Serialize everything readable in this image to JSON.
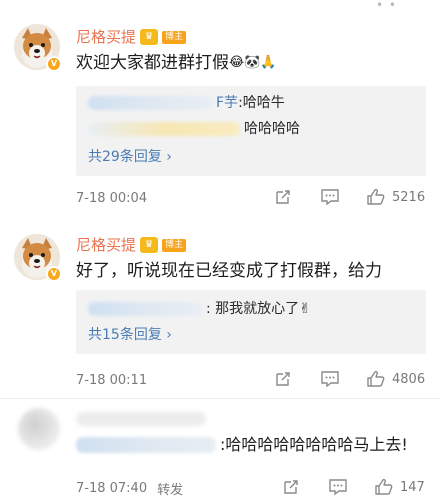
{
  "comments": [
    {
      "username": "尼格买提",
      "tag": "博主",
      "vip_badge": "V",
      "text": "欢迎大家都进群打假",
      "emojis": [
        "😂",
        "🐼",
        "🙏"
      ],
      "replies": [
        {
          "author_suffix": "F芋",
          "text": ":哈哈牛"
        },
        {
          "author_suffix": "",
          "text": "哈哈哈哈"
        }
      ],
      "reply_count_label": "共29条回复 ›",
      "timestamp": "7-18 00:04",
      "likes": "5216"
    },
    {
      "username": "尼格买提",
      "tag": "博主",
      "vip_badge": "V",
      "text": "好了，听说现在已经变成了打假群，给力",
      "emojis": [],
      "replies": [
        {
          "author_suffix": "",
          "text": ": 那我就放心了✌"
        }
      ],
      "reply_count_label": "共15条回复 ›",
      "timestamp": "7-18 00:11",
      "likes": "4806"
    },
    {
      "username": "",
      "text": ":哈哈哈哈哈哈哈哈马上去!",
      "timestamp": "7-18 07:40",
      "repost_label": "转发",
      "likes": "147"
    }
  ],
  "icons": {
    "share": "share-icon",
    "comment": "comment-icon",
    "like": "thumb-up-icon"
  },
  "colors": {
    "username": "#eb7350",
    "link": "#4b7cb5",
    "reply_bg": "#f2f2f2"
  }
}
